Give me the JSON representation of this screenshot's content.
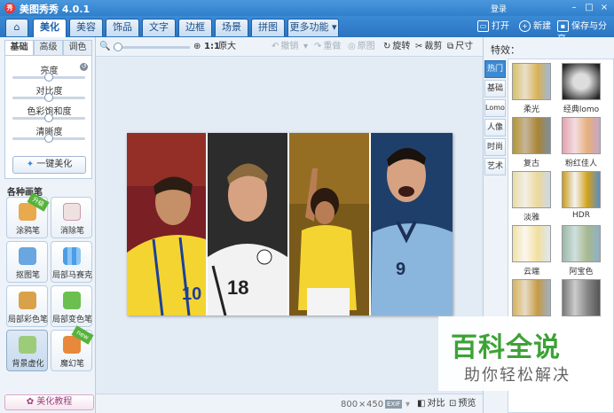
{
  "app": {
    "logo_text": "秀",
    "title": "美图秀秀 4.0.1",
    "login": "登录",
    "window_buttons": [
      "–",
      "□",
      "×"
    ]
  },
  "tabs": [
    {
      "label": "美化",
      "active": true
    },
    {
      "label": "美容"
    },
    {
      "label": "饰品"
    },
    {
      "label": "文字"
    },
    {
      "label": "边框"
    },
    {
      "label": "场景"
    },
    {
      "label": "拼图"
    },
    {
      "label": "更多功能 ▾"
    }
  ],
  "top_actions": {
    "open": "打开",
    "new": "新建",
    "save_share": "保存与分享"
  },
  "left_panel": {
    "adjust_tabs": [
      "基础",
      "高级",
      "调色"
    ],
    "sliders": [
      {
        "label": "亮度",
        "value": 0.5
      },
      {
        "label": "对比度",
        "value": 0.5
      },
      {
        "label": "色彩饱和度",
        "value": 0.5
      },
      {
        "label": "清晰度",
        "value": 0.5
      }
    ],
    "one_click": "一键美化",
    "brushes_title": "各种画笔",
    "brushes": [
      {
        "label": "涂鸦笔",
        "ribbon": "升级"
      },
      {
        "label": "消除笔"
      },
      {
        "label": "抠图笔"
      },
      {
        "label": "局部马赛克"
      },
      {
        "label": "局部彩色笔"
      },
      {
        "label": "局部变色笔"
      },
      {
        "label": "背景虚化"
      },
      {
        "label": "魔幻笔",
        "ribbon": "new"
      }
    ],
    "tutorial": "美化教程"
  },
  "toolbar": {
    "zoom_icon": "🔍",
    "ratio": "1:1",
    "original": "原大",
    "undo": "撤销",
    "redo": "重做",
    "restore": "原图",
    "rotate": "旋转",
    "crop": "裁剪",
    "size": "尺寸"
  },
  "status": {
    "width": "800",
    "times": "×",
    "height": "450",
    "exif": "EXIF",
    "compare": "对比",
    "preview": "预览"
  },
  "right_panel": {
    "title": "特效：",
    "categories": [
      "热门",
      "基础",
      "Lomo",
      "人像",
      "时尚",
      "艺术"
    ],
    "effects": [
      {
        "label": "柔光"
      },
      {
        "label": "经典lomo"
      },
      {
        "label": "复古"
      },
      {
        "label": "粉红佳人"
      },
      {
        "label": "淡雅"
      },
      {
        "label": "HDR"
      },
      {
        "label": "云端"
      },
      {
        "label": "阿宝色"
      },
      {
        "label": ""
      },
      {
        "label": ""
      }
    ]
  },
  "photo": {
    "panels": [
      {
        "jersey": "10",
        "shirt": "#f4d430",
        "bg": "#7a1f24",
        "skin": "#c58f67"
      },
      {
        "jersey": "18",
        "shirt": "#f2f2f2",
        "bg": "#2c2c2c",
        "skin": "#d6a282"
      },
      {
        "jersey": "",
        "shirt": "#f4d430",
        "bg": "#7a5a1a",
        "skin": "#b97d55"
      },
      {
        "jersey": "9",
        "shirt": "#8ab6dd",
        "bg": "#1f3f6b",
        "skin": "#d6a282"
      }
    ]
  },
  "watermark": {
    "main": "百科全说",
    "sub": "助你轻松解决"
  }
}
